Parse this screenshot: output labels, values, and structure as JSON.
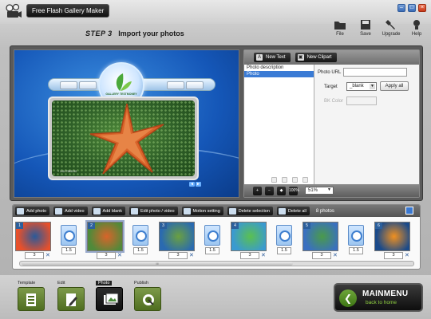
{
  "app": {
    "title": "Free Flash Gallery Maker"
  },
  "window_controls": {
    "minimize": "–",
    "maximize": "□",
    "close": "×"
  },
  "header": {
    "step": "STEP 3",
    "title": "Import your photos"
  },
  "top_tools": [
    {
      "label": "File",
      "icon": "folder-icon"
    },
    {
      "label": "Save",
      "icon": "floppy-icon"
    },
    {
      "label": "Upgrade",
      "icon": "wrench-icon"
    },
    {
      "label": "Help",
      "icon": "help-bulb-icon"
    }
  ],
  "preview": {
    "logo_text": "GALLERY TESTMONEY",
    "caption": "+ 10117989230",
    "nav_prev": "◄",
    "nav_next": "►"
  },
  "settings": {
    "new_text": "New Text",
    "new_clipart": "New Clipart",
    "layers": [
      "Photo description",
      "Photo"
    ],
    "selected_layer": 1,
    "photo_url_label": "Photo URL",
    "photo_url_value": "",
    "target_label": "Target",
    "target_value": "_blank",
    "apply_all": "Apply all",
    "bk_color_label": "BK Color",
    "zoom_value": "51%",
    "zoom_icons": [
      "zoom-in-icon",
      "zoom-out-icon",
      "fit-icon",
      "actual-size-icon"
    ],
    "zoom_icon_labels": [
      "+",
      "−",
      "◆",
      "100%"
    ]
  },
  "strip": {
    "buttons": [
      "Add photo",
      "Add video",
      "Add blank",
      "Edit photo / video",
      "Motion setting",
      "Delete selection",
      "Delete all"
    ],
    "photo_count": "8 photos",
    "photos": [
      {
        "num": "1",
        "duration": "3",
        "colors": [
          "#e8502a",
          "#2a5a9a"
        ]
      },
      {
        "num": "2",
        "duration": "3",
        "colors": [
          "#4f8a3a",
          "#d8642a"
        ]
      },
      {
        "num": "3",
        "duration": "3",
        "colors": [
          "#2a6ab0",
          "#6aa040"
        ]
      },
      {
        "num": "4",
        "duration": "3",
        "colors": [
          "#3a9ad0",
          "#5ac050"
        ]
      },
      {
        "num": "5",
        "duration": "3",
        "colors": [
          "#3a70c0",
          "#4a9a4a"
        ]
      },
      {
        "num": "6",
        "duration": "3",
        "colors": [
          "#1a4a8a",
          "#f09020"
        ]
      }
    ],
    "transition_value": "1.5",
    "delete_glyph": "✕",
    "scroll_label": "III"
  },
  "steps": [
    {
      "label": "Template",
      "icon": "template-icon",
      "active": false
    },
    {
      "label": "Edit",
      "icon": "edit-icon",
      "active": false
    },
    {
      "label": "Photo",
      "icon": "photo-icon",
      "active": true
    },
    {
      "label": "Publish",
      "icon": "publish-icon",
      "active": false
    }
  ],
  "mainmenu": {
    "title": "MAINMENU",
    "subtitle": "back to home",
    "arrow": "❮"
  }
}
